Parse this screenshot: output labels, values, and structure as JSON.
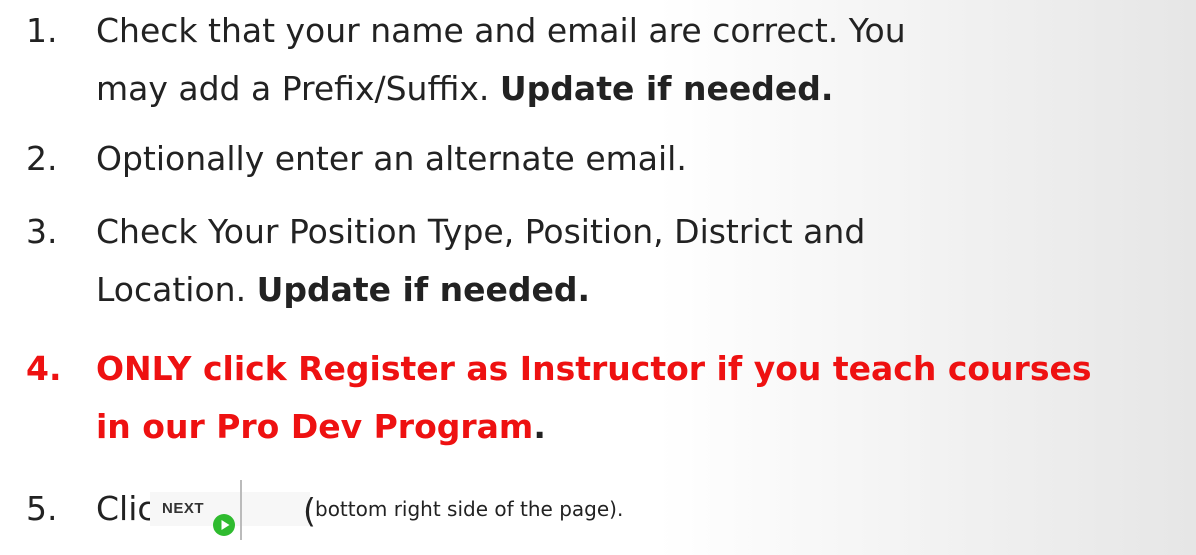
{
  "items": [
    {
      "number": "1.",
      "line1": "Check that your name and email are correct. You",
      "line2_text": "may add a Prefix/Suffix. ",
      "line2_bold": "Update if needed."
    },
    {
      "number": "2.",
      "text": "Optionally enter an alternate email."
    },
    {
      "number": "3.",
      "line1": "Check Your Position Type, Position, District and",
      "line2_text": "Location. ",
      "line2_bold": "Update if needed."
    },
    {
      "number": "4.",
      "line1": "ONLY click Register as Instructor if you teach courses",
      "line2_red": "in our Pro Dev Program",
      "line2_after": "."
    },
    {
      "number": "5.",
      "text": "Click",
      "button_label": "NEXT",
      "paren": "(",
      "note": "bottom right side of the page)."
    }
  ],
  "colors": {
    "text": "#222222",
    "emphasis_red": "#ee1111",
    "play_green": "#2fbb2f"
  },
  "icons": {
    "next_button_icon": "play-icon"
  }
}
